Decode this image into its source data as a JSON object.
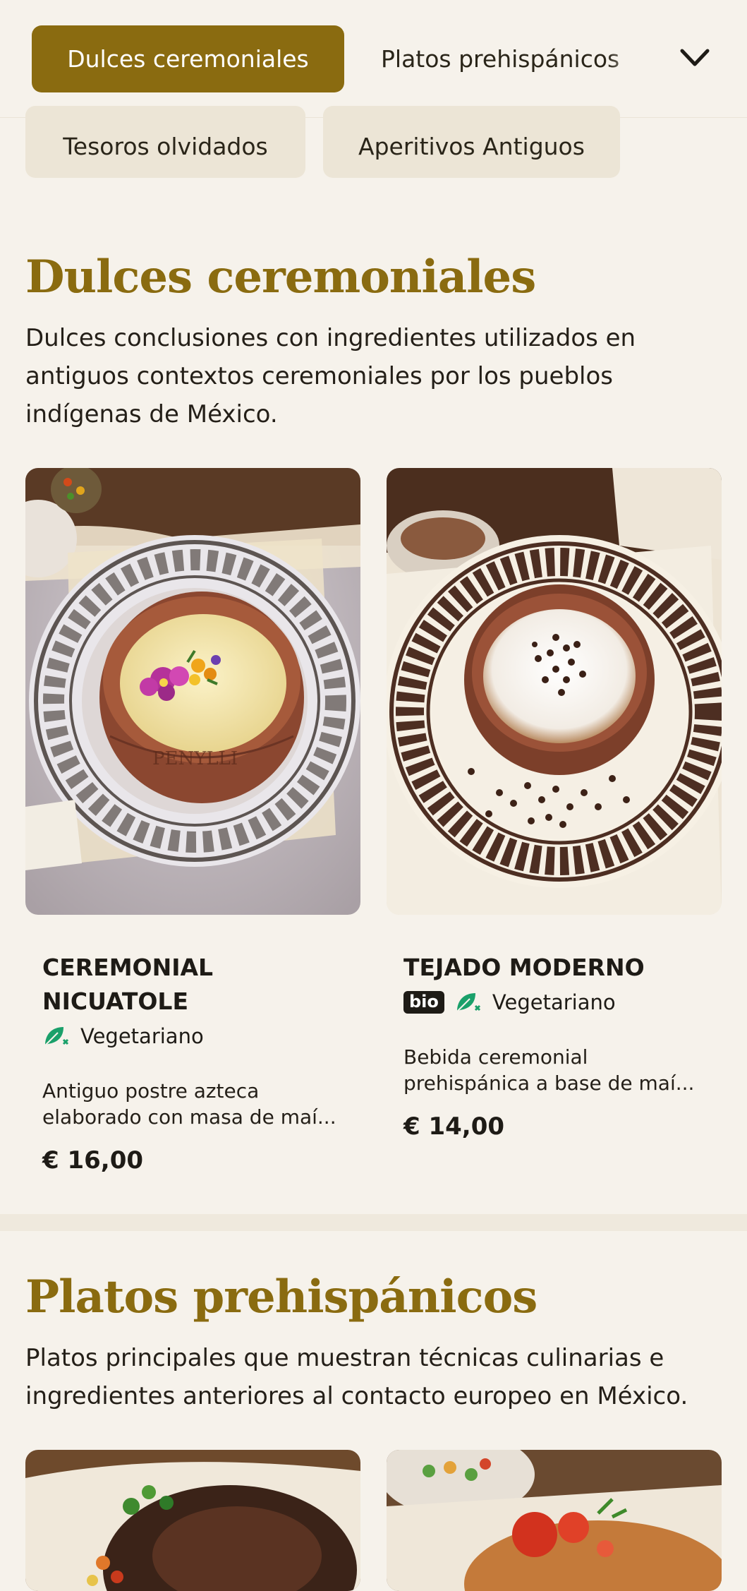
{
  "categories": {
    "items": [
      {
        "label": "Dulces ceremoniales",
        "active": true
      },
      {
        "label": "Platos prehispánicos",
        "active": false
      },
      {
        "label": "Tesoros olvidados",
        "active": false
      },
      {
        "label": "Aperitivos Antiguos",
        "active": false
      }
    ],
    "expand_icon": "chevron-down-icon"
  },
  "sections": [
    {
      "title": "Dulces ceremoniales",
      "description": "Dulces conclusiones con ingredientes utilizados en antiguos contextos ceremoniales por los pueblos indígenas de México.",
      "products": [
        {
          "name": "CEREMONIAL NICUATOLE",
          "tags": [
            {
              "icon": "vegetarian-leaf-icon",
              "label": "Vegetariano"
            }
          ],
          "description_line1": "Antiguo postre azteca",
          "description_line2": "elaborado con masa de maí...",
          "price": "€ 16,00"
        },
        {
          "name": "TEJADO MODERNO",
          "bio_label": "bio",
          "tags": [
            {
              "icon": "vegetarian-leaf-icon",
              "label": "Vegetariano"
            }
          ],
          "description_line1": "Bebida ceremonial",
          "description_line2": "prehispánica a base de maí...",
          "price": "€ 14,00"
        }
      ]
    },
    {
      "title": "Platos prehispánicos",
      "description": "Platos principales que muestran técnicas culinarias e ingredientes anteriores al contacto europeo en México."
    }
  ],
  "colors": {
    "accent": "#8a6b10",
    "background": "#f6f2eb",
    "pill_muted": "#ece5d6",
    "vegetarian_icon": "#1aa06a"
  }
}
